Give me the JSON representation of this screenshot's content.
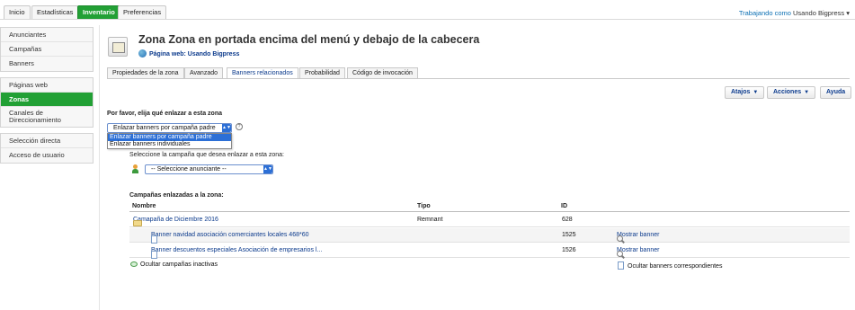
{
  "top_tabs": [
    "Inicio",
    "Estadísticas",
    "Inventario",
    "Preferencias"
  ],
  "user": {
    "prefix": "Trabajando como",
    "name": "Usando Bigpress",
    "caret": "▾"
  },
  "sidebar": {
    "group1": [
      "Anunciantes",
      "Campañas",
      "Banners"
    ],
    "group2": [
      "Páginas web",
      "Zonas",
      "Canales de Direccionamiento"
    ],
    "group3": [
      "Selección directa",
      "Acceso de usuario"
    ]
  },
  "header": {
    "title_prefix": "Zona",
    "title_rest": "Zona en portada encima del menú y debajo de la cabecera",
    "website_label": "Página web: Usando Bigpress"
  },
  "tabs": [
    "Propiedades de la zona",
    "Avanzado",
    "Banners relacionados",
    "Probabilidad",
    "Código de invocación"
  ],
  "buttons": {
    "shortcuts": "Atajos",
    "actions": "Acciones",
    "help": "Ayuda"
  },
  "form": {
    "link_label": "Por favor, elija qué enlazar a esta zona",
    "link_selected": "Enlazar banners por campaña padre",
    "link_options": [
      "Enlazar banners por campaña padre",
      "Enlazar banners individuales"
    ],
    "campaign_label": "Seleccione la campaña que desea enlazar a esta zona:",
    "advertiser_selected": "-- Seleccione anunciante --"
  },
  "table": {
    "title": "Campañas enlazadas a la zona:",
    "headers": {
      "name": "Nombre",
      "type": "Tipo",
      "id": "ID"
    },
    "campaign": {
      "collapse": "«",
      "name": "Camapaña de Diciembre 2016",
      "type": "Remnant",
      "id": "628"
    },
    "banners": [
      {
        "name": "Banner navidad asociación comerciantes locales 468*60",
        "id": "1525",
        "action": "Mostrar banner"
      },
      {
        "name": "Banner descuentos especiales Asociación de empresarios l...",
        "id": "1526",
        "action": "Mostrar banner"
      }
    ],
    "hide_inactive": "Ocultar campañas inactivas",
    "hide_banners": "Ocultar banners correspondientes"
  }
}
